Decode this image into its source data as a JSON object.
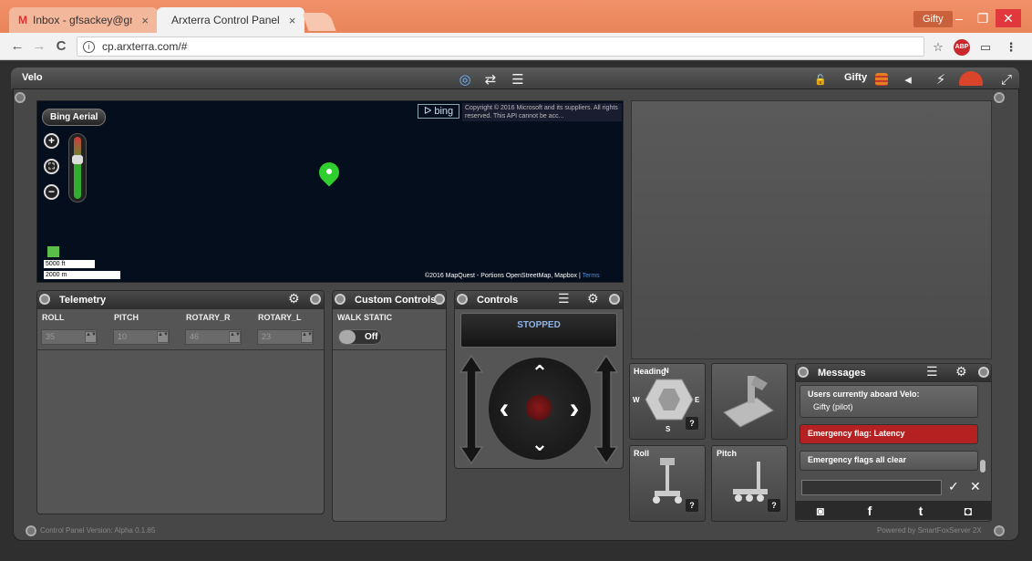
{
  "browser": {
    "tabs": [
      {
        "icon": "M",
        "label": "Inbox - gfsackey@gmail",
        "close": "×"
      },
      {
        "label": "Arxterra Control Panel",
        "close": "×"
      }
    ],
    "profile": "Gifty",
    "window_controls": {
      "minimize": "–",
      "restore": "❐",
      "close": "✕"
    },
    "nav": {
      "back": "←",
      "forward": "→",
      "reload": "C"
    },
    "url": "cp.arxterra.com/#",
    "info_icon": "i",
    "extensions": {
      "star": "☆",
      "abp": "ABP",
      "cast": "▭",
      "menu": "⋮"
    }
  },
  "app": {
    "robot_name": "Velo",
    "top_user": "Gifty",
    "top_icons": {
      "target": "◎",
      "swap": "⇄",
      "menu": "☰",
      "lock": "🔓",
      "back": "◂",
      "bolt": "⚡",
      "expand": "⤢"
    },
    "version": "Control Panel Version: Alpha 0.1.85",
    "powered": "Powered by SmartFoxServer 2X"
  },
  "map": {
    "mode_button": "Bing Aerial",
    "zoom_in": "+",
    "zoom_fit": "⛶",
    "zoom_out": "−",
    "bing_logo": "ᐅ bing",
    "copyright": "Copyright © 2016 Microsoft and its suppliers. All rights reserved. This API cannot be acc...",
    "scale_ft": "5000 ft",
    "scale_m": "2000 m",
    "attribution": "©2016 MapQuest - Portions  OpenStreetMap, Mapbox |",
    "terms": "Terms"
  },
  "telemetry": {
    "title": "Telemetry",
    "gear": "⚙",
    "fields": [
      {
        "label": "ROLL",
        "value": "35"
      },
      {
        "label": "PITCH",
        "value": "10"
      },
      {
        "label": "ROTARY_R",
        "value": "46"
      },
      {
        "label": "ROTARY_L",
        "value": "23"
      }
    ],
    "spin": "▲▼"
  },
  "custom_controls": {
    "title": "Custom Controls",
    "walk_label": "WALK STATIC",
    "toggle_value": "Off"
  },
  "controls": {
    "title": "Controls",
    "menu": "☰",
    "gear": "⚙",
    "status": "STOPPED",
    "up": "⌃",
    "down": "⌄",
    "left": "‹",
    "right": "›"
  },
  "gauges": {
    "heading": "Heading",
    "roll": "Roll",
    "pitch": "Pitch",
    "help": "?",
    "compass": {
      "n": "N",
      "e": "E",
      "s": "S",
      "w": "W"
    }
  },
  "messages": {
    "title": "Messages",
    "menu": "☰",
    "gear": "⚙",
    "aboard_title": "Users currently aboard Velo:",
    "aboard_user": "Gifty (pilot)",
    "flag_latency": "Emergency flag: Latency",
    "flag_clear": "Emergency flags all clear",
    "send": "✓",
    "cancel": "✕",
    "social": {
      "camera": "◙",
      "facebook": "f",
      "twitter": "t",
      "instagram": "◘"
    }
  },
  "colors": {
    "tab_bar": "#ea8459",
    "latency_flag": "#b52020",
    "status_text": "#8fb3e8",
    "pin": "#2fcf2f"
  }
}
